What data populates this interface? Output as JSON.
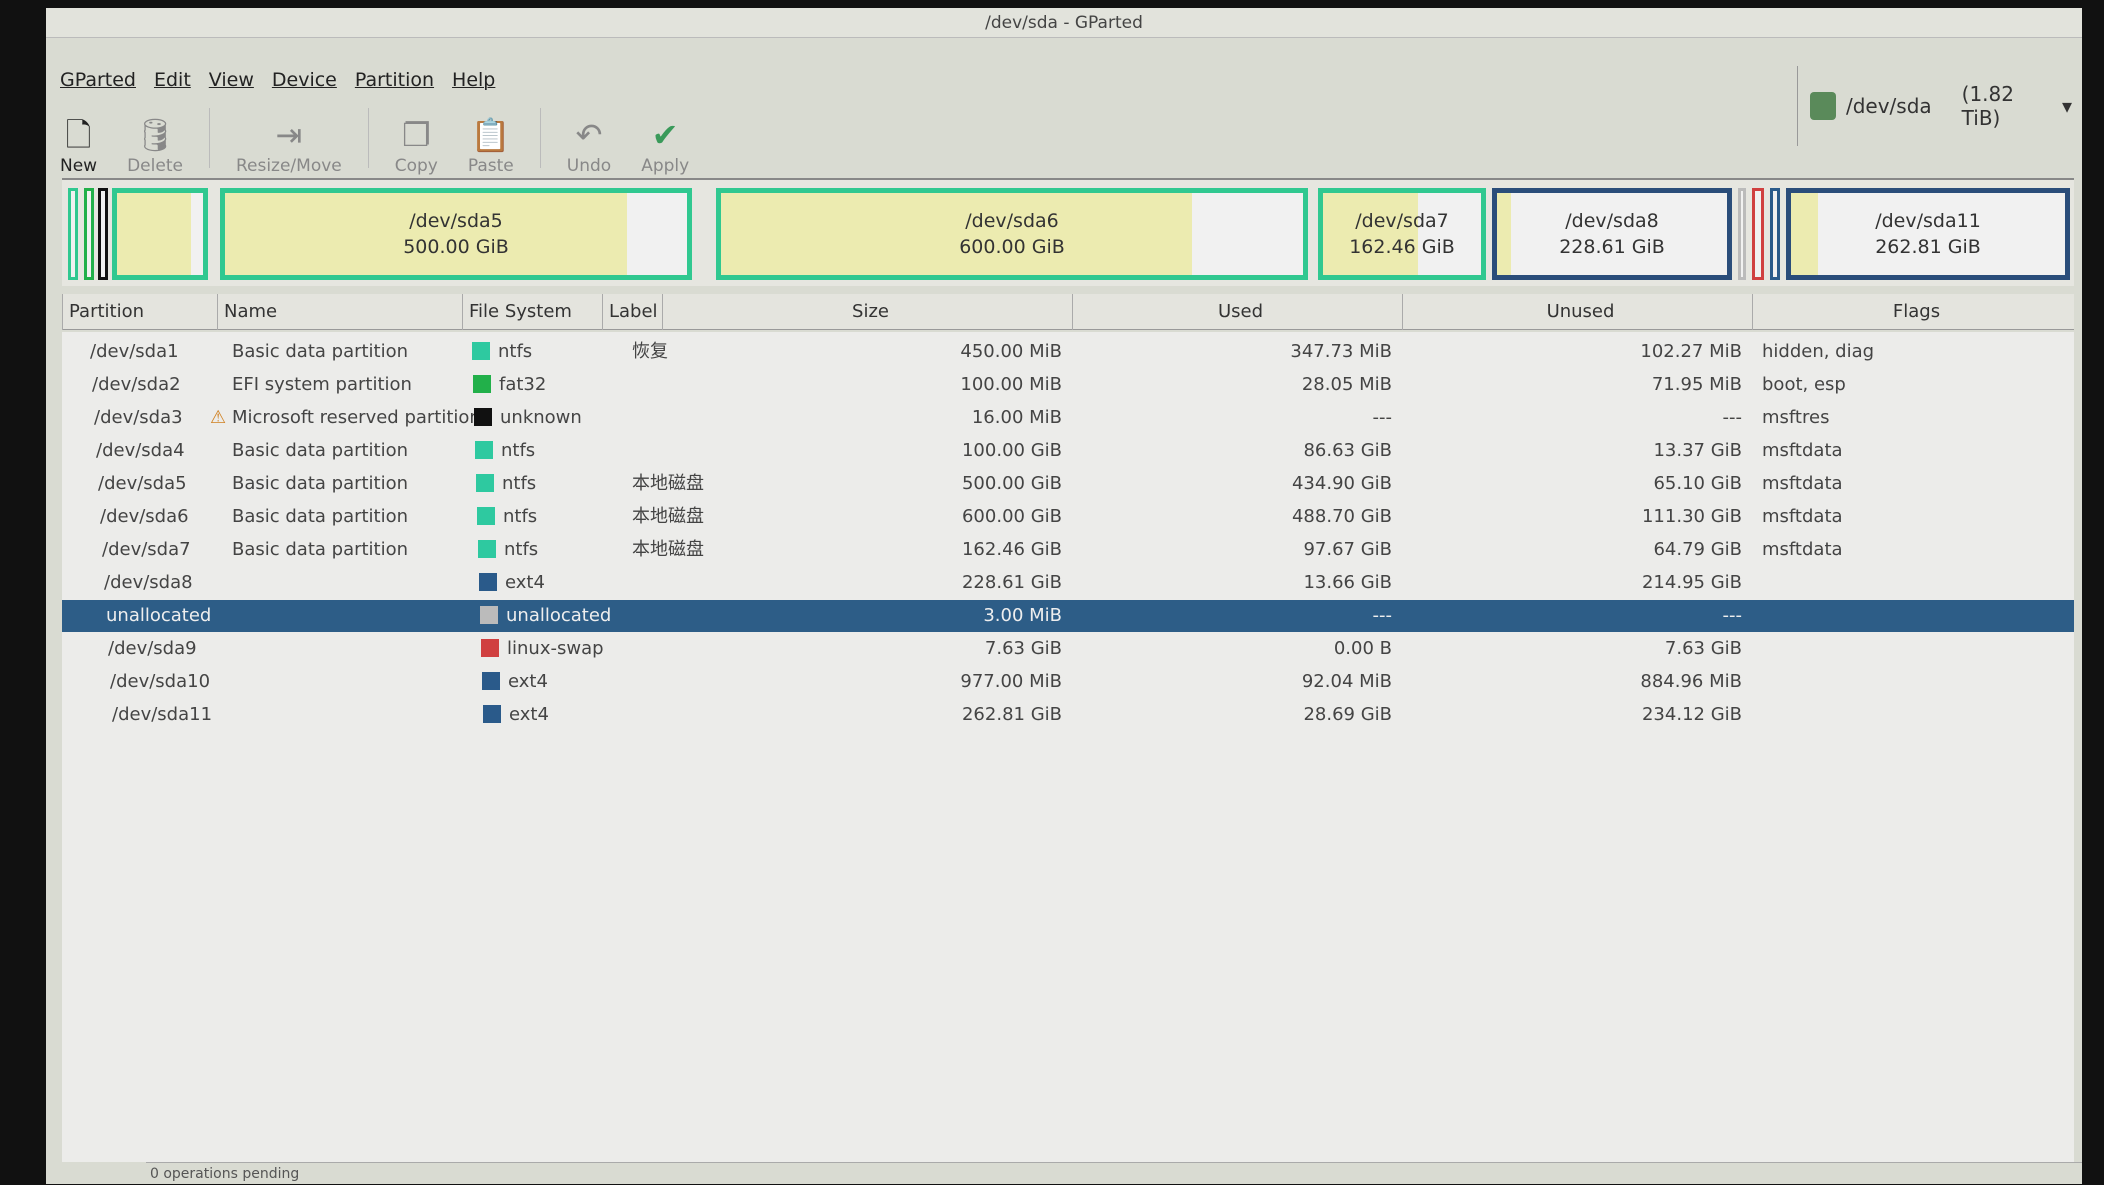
{
  "window": {
    "title": "/dev/sda - GParted"
  },
  "menu": [
    "GParted",
    "Edit",
    "View",
    "Device",
    "Partition",
    "Help"
  ],
  "toolbar": [
    {
      "label": "New",
      "icon": "new-file-icon",
      "enabled": true
    },
    {
      "label": "Delete",
      "icon": "delete-icon",
      "enabled": false
    },
    {
      "label": "Resize/Move",
      "icon": "resize-move-icon",
      "enabled": false
    },
    {
      "label": "Copy",
      "icon": "copy-icon",
      "enabled": false
    },
    {
      "label": "Paste",
      "icon": "paste-icon",
      "enabled": false
    },
    {
      "label": "Undo",
      "icon": "undo-icon",
      "enabled": false
    },
    {
      "label": "Apply",
      "icon": "apply-check-icon",
      "enabled": false
    }
  ],
  "device": {
    "name": "/dev/sda",
    "size": "(1.82 TiB)"
  },
  "graph": [
    {
      "name": "/dev/sda5",
      "size": "500.00 GiB"
    },
    {
      "name": "/dev/sda6",
      "size": "600.00 GiB"
    },
    {
      "name": "/dev/sda7",
      "size": "162.46 GiB"
    },
    {
      "name": "/dev/sda8",
      "size": "228.61 GiB"
    },
    {
      "name": "/dev/sda11",
      "size": "262.81 GiB"
    }
  ],
  "columns": [
    "Partition",
    "Name",
    "File System",
    "Label",
    "Size",
    "Used",
    "Unused",
    "Flags"
  ],
  "rows": [
    {
      "p": "/dev/sda1",
      "n": "Basic data partition",
      "fs": "ntfs",
      "c": "#2ec9a0",
      "l": "恢复",
      "s": "450.00 MiB",
      "u": "347.73 MiB",
      "f": "102.27 MiB",
      "fl": "hidden, diag"
    },
    {
      "p": "/dev/sda2",
      "n": "EFI system partition",
      "fs": "fat32",
      "c": "#22b04a",
      "l": "",
      "s": "100.00 MiB",
      "u": "28.05 MiB",
      "f": "71.95 MiB",
      "fl": "boot, esp"
    },
    {
      "p": "/dev/sda3",
      "n": "Microsoft reserved partition",
      "fs": "unknown",
      "c": "#111111",
      "l": "",
      "s": "16.00 MiB",
      "u": "---",
      "f": "---",
      "fl": "msftres",
      "warn": true
    },
    {
      "p": "/dev/sda4",
      "n": "Basic data partition",
      "fs": "ntfs",
      "c": "#2ec9a0",
      "l": "",
      "s": "100.00 GiB",
      "u": "86.63 GiB",
      "f": "13.37 GiB",
      "fl": "msftdata"
    },
    {
      "p": "/dev/sda5",
      "n": "Basic data partition",
      "fs": "ntfs",
      "c": "#2ec9a0",
      "l": "本地磁盘",
      "s": "500.00 GiB",
      "u": "434.90 GiB",
      "f": "65.10 GiB",
      "fl": "msftdata"
    },
    {
      "p": "/dev/sda6",
      "n": "Basic data partition",
      "fs": "ntfs",
      "c": "#2ec9a0",
      "l": "本地磁盘",
      "s": "600.00 GiB",
      "u": "488.70 GiB",
      "f": "111.30 GiB",
      "fl": "msftdata"
    },
    {
      "p": "/dev/sda7",
      "n": "Basic data partition",
      "fs": "ntfs",
      "c": "#2ec9a0",
      "l": "本地磁盘",
      "s": "162.46 GiB",
      "u": "97.67 GiB",
      "f": "64.79 GiB",
      "fl": "msftdata"
    },
    {
      "p": "/dev/sda8",
      "n": "",
      "fs": "ext4",
      "c": "#2a5a8a",
      "l": "",
      "s": "228.61 GiB",
      "u": "13.66 GiB",
      "f": "214.95 GiB",
      "fl": ""
    },
    {
      "p": "unallocated",
      "n": "",
      "fs": "unallocated",
      "c": "#bbbbbb",
      "l": "",
      "s": "3.00 MiB",
      "u": "---",
      "f": "---",
      "fl": "",
      "selected": true
    },
    {
      "p": "/dev/sda9",
      "n": "",
      "fs": "linux-swap",
      "c": "#d04040",
      "l": "",
      "s": "7.63 GiB",
      "u": "0.00 B",
      "f": "7.63 GiB",
      "fl": ""
    },
    {
      "p": "/dev/sda10",
      "n": "",
      "fs": "ext4",
      "c": "#2a5a8a",
      "l": "",
      "s": "977.00 MiB",
      "u": "92.04 MiB",
      "f": "884.96 MiB",
      "fl": ""
    },
    {
      "p": "/dev/sda11",
      "n": "",
      "fs": "ext4",
      "c": "#2a5a8a",
      "l": "",
      "s": "262.81 GiB",
      "u": "28.69 GiB",
      "f": "234.12 GiB",
      "fl": ""
    }
  ],
  "status": "0 operations pending"
}
